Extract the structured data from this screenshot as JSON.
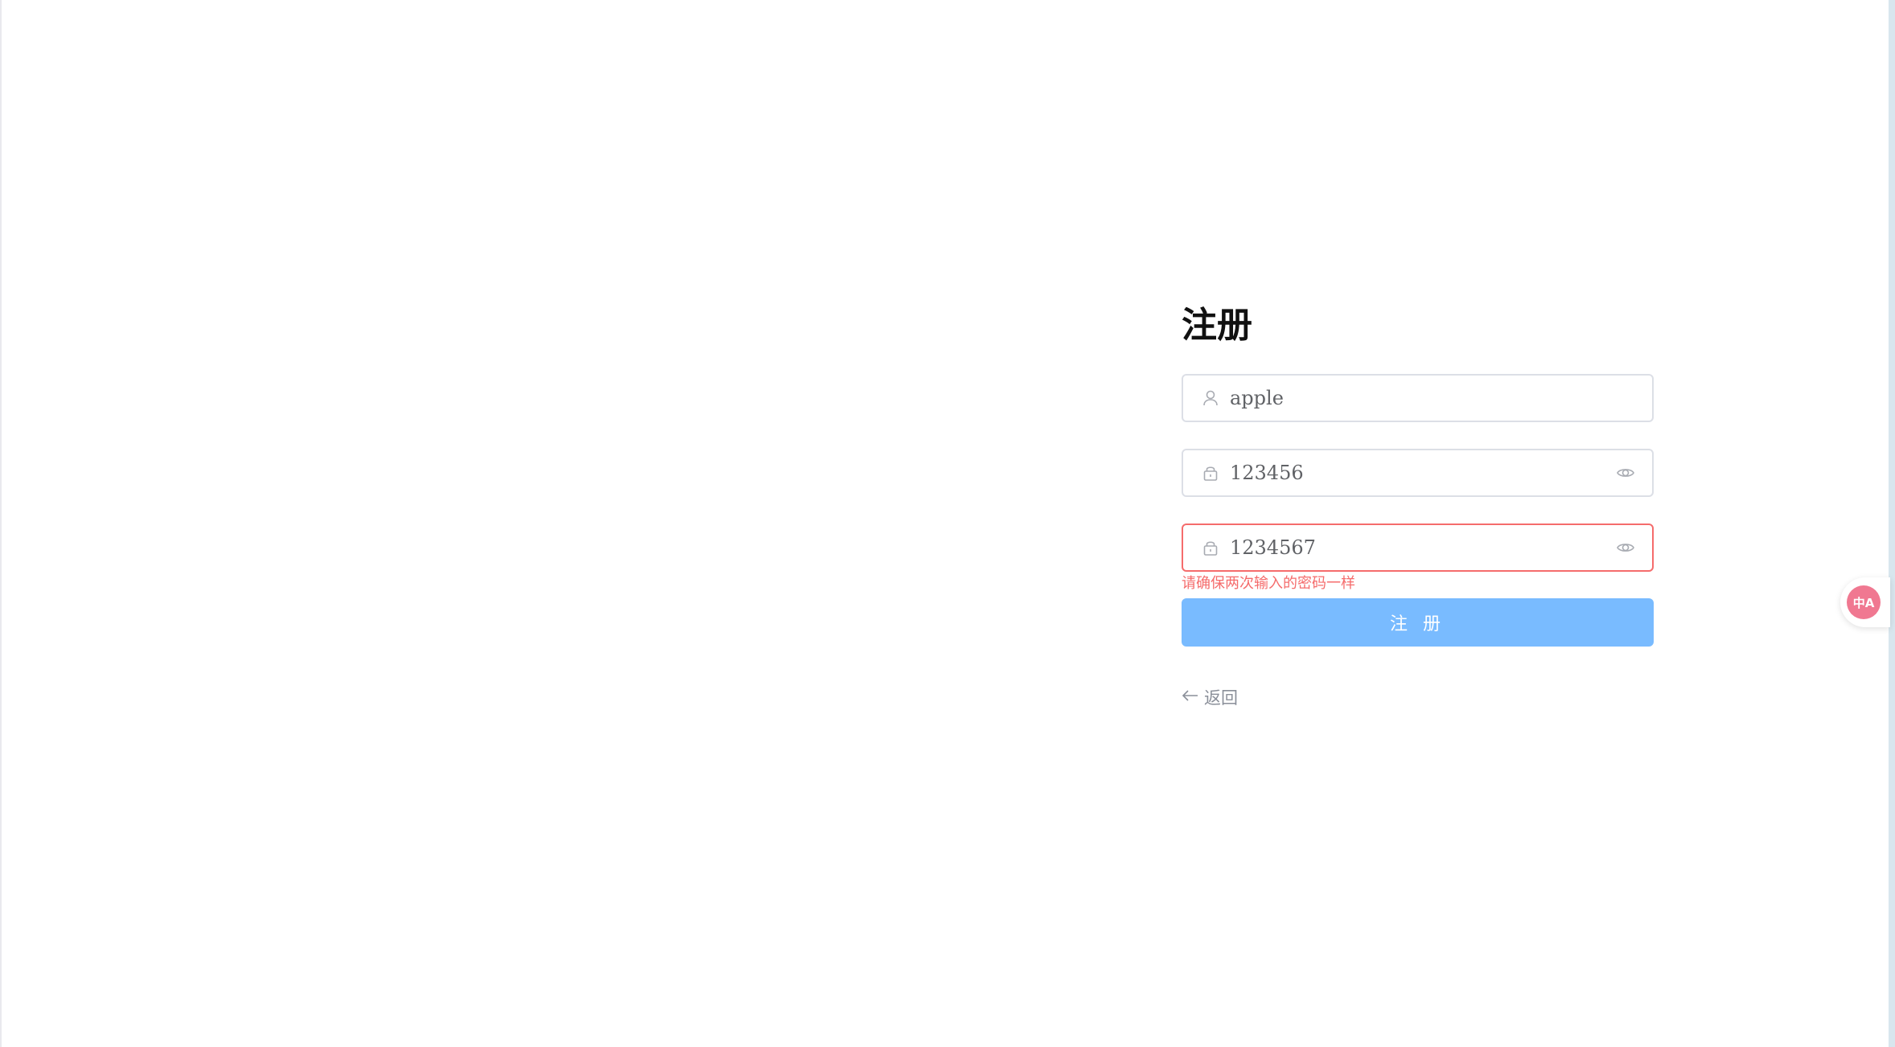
{
  "form": {
    "title": "注册",
    "username": {
      "value": "apple",
      "icon": "user-icon"
    },
    "password": {
      "value": "123456",
      "icon": "lock-icon",
      "suffix_icon": "eye-icon"
    },
    "confirm_password": {
      "value": "1234567",
      "icon": "lock-icon",
      "suffix_icon": "eye-icon",
      "error": "请确保两次输入的密码一样"
    },
    "submit_label": "注 册",
    "back_label": "返回"
  },
  "translate_widget": {
    "icon": "translate-icon",
    "glyph": "中A"
  },
  "colors": {
    "primary_disabled": "#79bbff",
    "error": "#f56c6c",
    "border": "#dcdfe6",
    "widget": "#f07891"
  }
}
